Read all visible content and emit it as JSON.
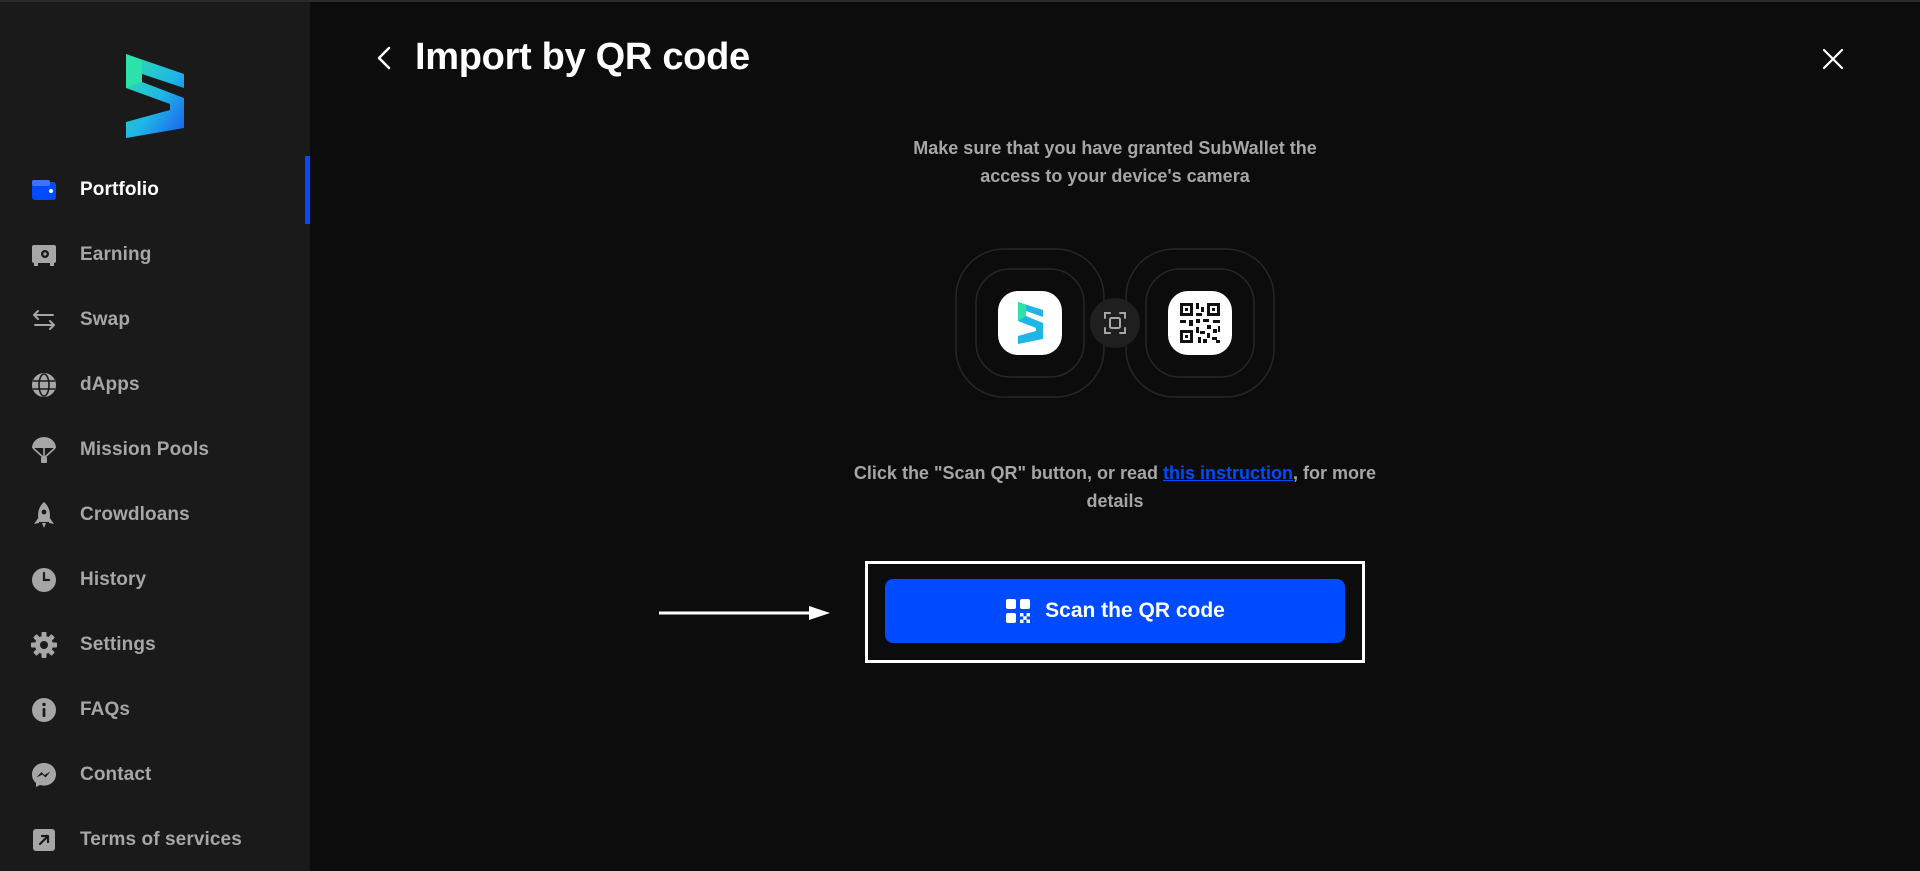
{
  "sidebar": {
    "items": [
      {
        "label": "Portfolio",
        "icon": "wallet-icon",
        "active": true
      },
      {
        "label": "Earning",
        "icon": "safe-icon"
      },
      {
        "label": "Swap",
        "icon": "swap-arrows-icon"
      },
      {
        "label": "dApps",
        "icon": "globe-icon"
      },
      {
        "label": "Mission Pools",
        "icon": "parachute-icon"
      },
      {
        "label": "Crowdloans",
        "icon": "rocket-icon"
      },
      {
        "label": "History",
        "icon": "clock-icon"
      },
      {
        "label": "Settings",
        "icon": "gear-icon"
      },
      {
        "label": "FAQs",
        "icon": "info-icon"
      },
      {
        "label": "Contact",
        "icon": "messenger-icon"
      },
      {
        "label": "Terms of services",
        "icon": "external-link-icon"
      }
    ]
  },
  "header": {
    "title": "Import by QR code"
  },
  "main": {
    "description": "Make sure that you have granted SubWallet the access to your device's camera",
    "instruction_prefix": "Click the \"Scan QR\" button, or read ",
    "instruction_link": "this instruction",
    "instruction_suffix": ", for more details",
    "scan_button_label": "Scan the QR code"
  },
  "colors": {
    "accent": "#004bff",
    "background": "#0c0c0c",
    "sidebar": "#1a1a1a",
    "muted_text": "#a6a6a6"
  }
}
